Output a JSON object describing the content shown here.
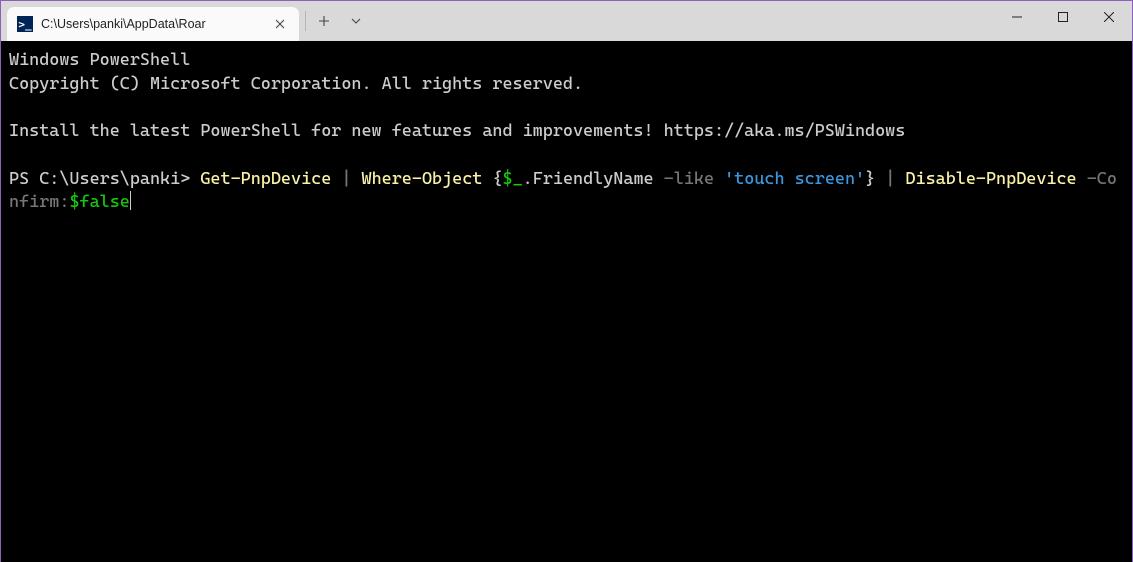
{
  "tab": {
    "title": "C:\\Users\\panki\\AppData\\Roar",
    "icon_label": ">_"
  },
  "terminal": {
    "header_line1": "Windows PowerShell",
    "header_line2": "Copyright (C) Microsoft Corporation. All rights reserved.",
    "install_msg": "Install the latest PowerShell for new features and improvements! https://aka.ms/PSWindows",
    "prompt": "PS C:\\Users\\panki> ",
    "cmd": {
      "t1": "Get-PnpDevice ",
      "t2": "| ",
      "t3": "Where-Object ",
      "t4": "{",
      "t5": "$_",
      "t6": ".FriendlyName ",
      "t7": "-like ",
      "t8": "'touch screen'",
      "t9": "} ",
      "t10": "| ",
      "t11": "Disable-PnpDevice ",
      "t12": "-Confirm:",
      "t13": "$false"
    }
  }
}
